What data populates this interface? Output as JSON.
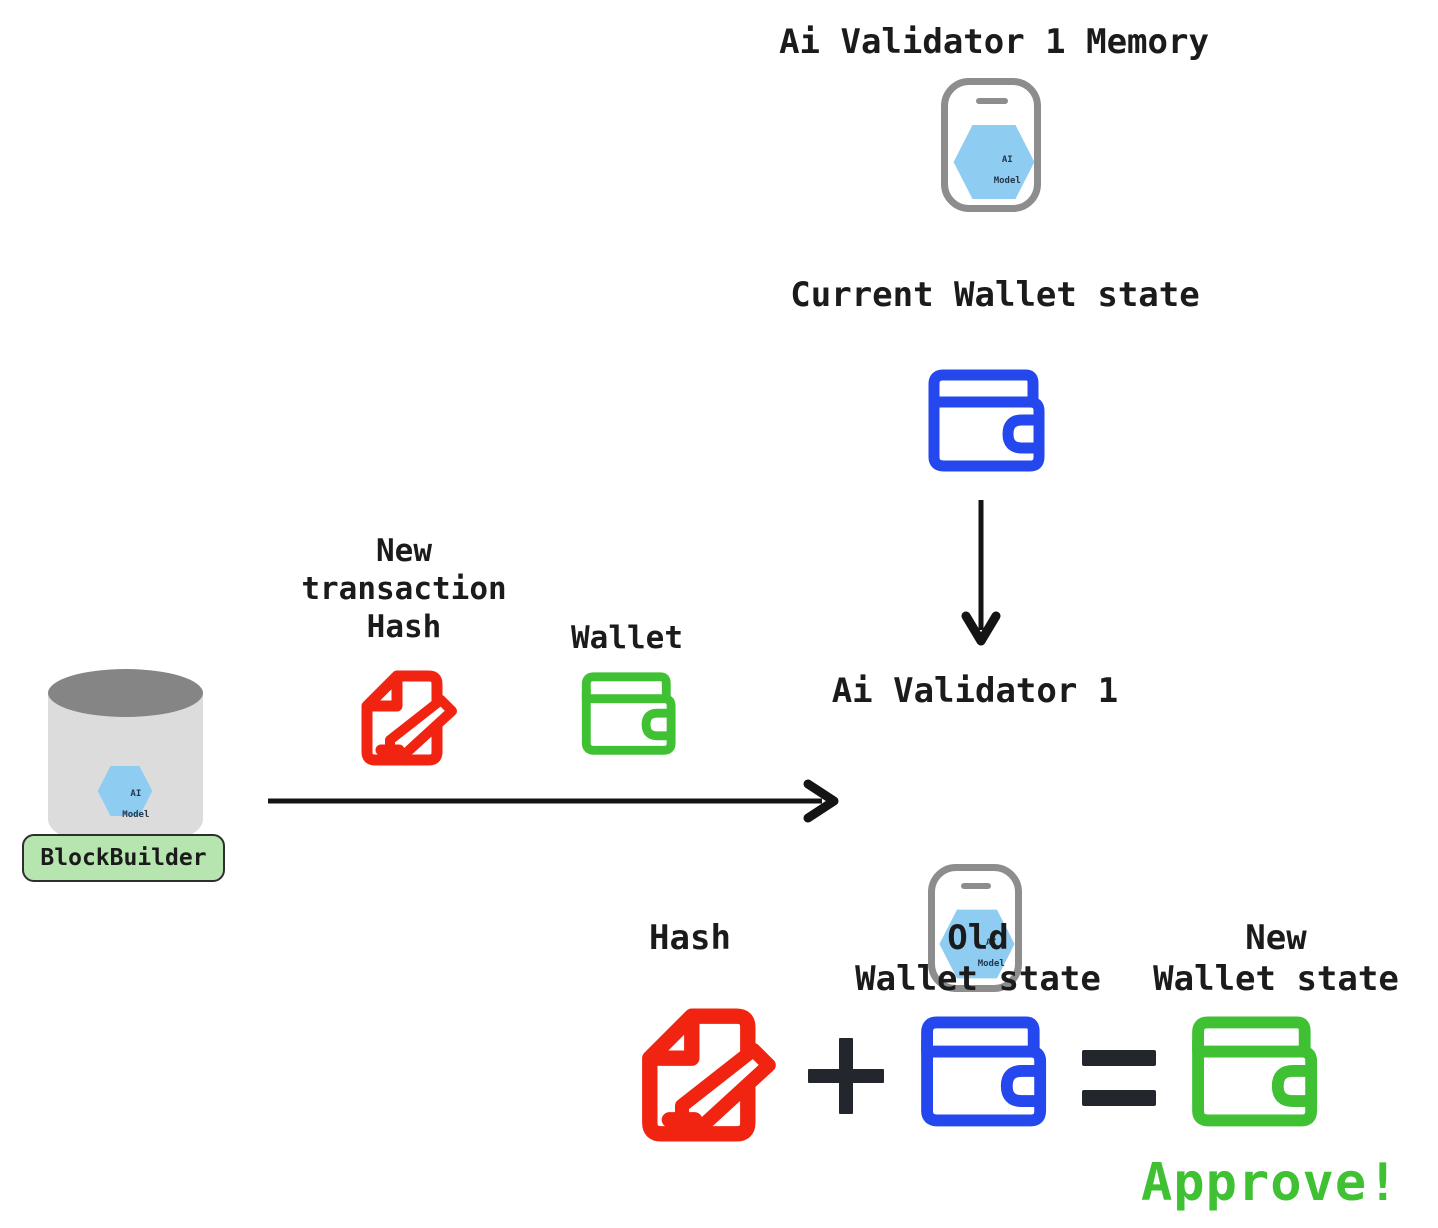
{
  "diagram": {
    "title_memory": "Ai Validator 1 Memory",
    "title_current_wallet_state": "Current Wallet state",
    "label_new_transaction_hash": "New\ntransaction\nHash",
    "label_wallet": "Wallet",
    "label_validator": "Ai Validator 1",
    "label_hash": "Hash",
    "label_old_wallet_state": "Old\nWallet state",
    "label_new_wallet_state": "New\nWallet state",
    "label_approve": "Approve!",
    "label_blockbuilder": "BlockBuilder",
    "ai_model_line1": "AI",
    "ai_model_line2": "Model",
    "operator_plus": "+",
    "operator_equals": "=",
    "icons": {
      "memory_device": "ai-model-device-icon",
      "validator_device": "ai-model-device-icon",
      "current_wallet": "wallet-icon-blue",
      "transaction_hash": "document-pencil-icon-red",
      "wallet_green": "wallet-icon-green",
      "old_wallet": "wallet-icon-blue",
      "new_wallet": "wallet-icon-green",
      "blockbuilder": "database-cylinder-icon",
      "arrow_down": "arrow-down-icon",
      "arrow_right": "arrow-right-icon"
    },
    "colors": {
      "red": "#f12411",
      "green": "#3fc133",
      "blue": "#2447ee",
      "dark": "#24262d",
      "device_gray": "#8d8d8d",
      "cylinder_body": "#dcdcdc",
      "cylinder_top": "#858585",
      "hexagon": "#8fccf2",
      "chip_fill": "#b6e5b0",
      "text": "#1b1b1b"
    }
  }
}
